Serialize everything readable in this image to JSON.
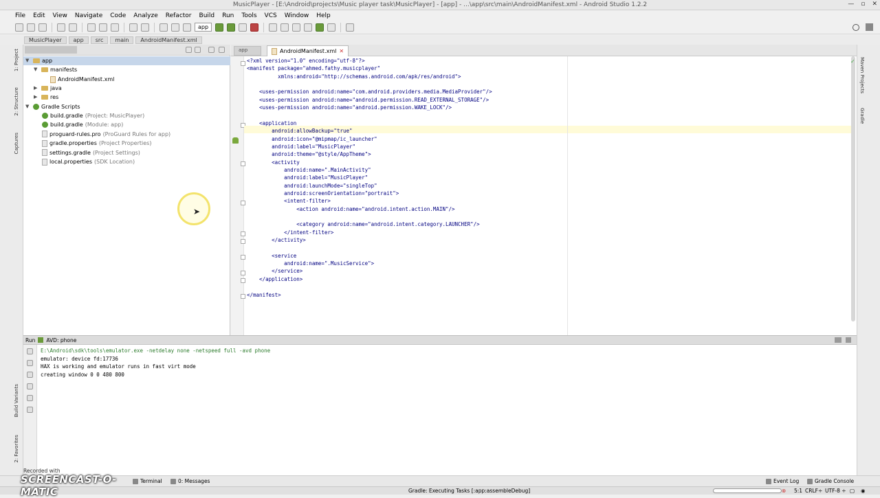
{
  "window": {
    "title": "MusicPlayer - [E:\\Android\\projects\\Music player task\\MusicPlayer] - [app] - ...\\app\\src\\main\\AndroidManifest.xml - Android Studio 1.2.2"
  },
  "menu": [
    "File",
    "Edit",
    "View",
    "Navigate",
    "Code",
    "Analyze",
    "Refactor",
    "Build",
    "Run",
    "Tools",
    "VCS",
    "Window",
    "Help"
  ],
  "toolbar": {
    "run_config": "app"
  },
  "breadcrumbs": [
    "MusicPlayer",
    "app",
    "src",
    "main",
    "AndroidManifest.xml"
  ],
  "left_tool_tabs": [
    "1: Project",
    "2: Structure",
    "Captures",
    "Build Variants",
    "2: Favorites"
  ],
  "right_tool_tabs": [
    "Maven Projects",
    "Gradle"
  ],
  "project_tree": {
    "root": "app",
    "manifests_label": "manifests",
    "manifest_file": "AndroidManifest.xml",
    "java_label": "java",
    "res_label": "res",
    "gradle_scripts_label": "Gradle Scripts",
    "gradle_files": [
      {
        "name": "build.gradle",
        "note": "(Project: MusicPlayer)"
      },
      {
        "name": "build.gradle",
        "note": "(Module: app)"
      },
      {
        "name": "proguard-rules.pro",
        "note": "(ProGuard Rules for app)"
      },
      {
        "name": "gradle.properties",
        "note": "(Project Properties)"
      },
      {
        "name": "settings.gradle",
        "note": "(Project Settings)"
      },
      {
        "name": "local.properties",
        "note": "(SDK Location)"
      }
    ]
  },
  "editor": {
    "tab_active": "AndroidManifest.xml",
    "tab_inactive": "app",
    "lines": [
      "<?xml version=\"1.0\" encoding=\"utf-8\"?>",
      "<manifest package=\"ahmed.fathy.musicplayer\"",
      "          xmlns:android=\"http://schemas.android.com/apk/res/android\">",
      "",
      "    <uses-permission android:name=\"com.android.providers.media.MediaProvider\"/>",
      "    <uses-permission android:name=\"android.permission.READ_EXTERNAL_STORAGE\"/>",
      "    <uses-permission android:name=\"android.permission.WAKE_LOCK\"/>",
      "",
      "    <application",
      "        android:allowBackup=\"true\"",
      "        android:icon=\"@mipmap/ic_launcher\"",
      "        android:label=\"MusicPlayer\"",
      "        android:theme=\"@style/AppTheme\">",
      "        <activity",
      "            android:name=\".MainActivity\"",
      "            android:label=\"MusicPlayer\"",
      "            android:launchMode=\"singleTop\"",
      "            android:screenOrientation=\"portrait\">",
      "            <intent-filter>",
      "                <action android:name=\"android.intent.action.MAIN\"/>",
      "",
      "                <category android:name=\"android.intent.category.LAUNCHER\"/>",
      "            </intent-filter>",
      "        </activity>",
      "",
      "        <service",
      "            android:name=\".MusicService\">",
      "        </service>",
      "    </application>",
      "",
      "</manifest>"
    ]
  },
  "run_panel": {
    "label": "Run",
    "config": "AVD: phone",
    "console": [
      "E:\\Android\\sdk\\tools\\emulator.exe -netdelay none -netspeed full -avd phone",
      "emulator: device fd:17736",
      "HAX is working and emulator runs in fast virt mode",
      "creating window 0 0 480 800"
    ]
  },
  "bottom_tabs": {
    "terminal": "Terminal",
    "messages": "0: Messages",
    "event_log": "Event Log",
    "gradle_console": "Gradle Console"
  },
  "status": {
    "task": "Gradle: Executing Tasks [:app:assembleDebug]",
    "position": "5:1",
    "line_sep": "CRLF÷",
    "encoding": "UTF-8 ÷"
  },
  "watermark": {
    "line1": "Recorded with",
    "line2": "SCREENCAST-O-MATIC"
  }
}
